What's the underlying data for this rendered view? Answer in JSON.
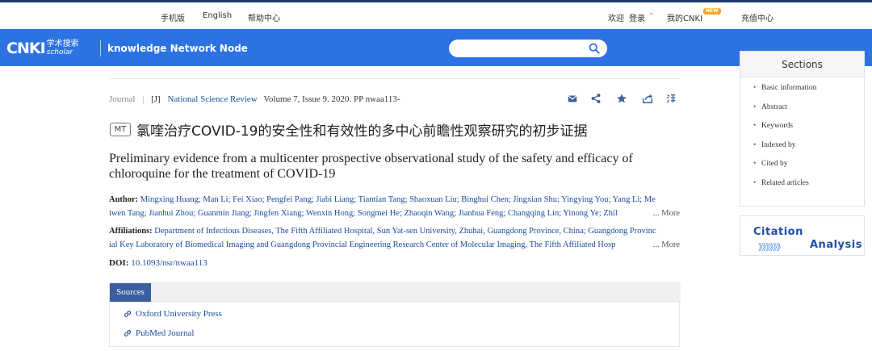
{
  "topbar": {
    "mobile": "手机版",
    "english": "English",
    "help": "帮助中心",
    "welcome": "欢迎",
    "login": "登录",
    "login_arrow": "⌄",
    "my_cnki": "我的CNKI",
    "new_badge": "NEW",
    "recharge": "充值中心"
  },
  "header": {
    "logo_main": "CNKI",
    "logo_cn": "学术搜索",
    "logo_en": "scholar",
    "site_name": "knowledge Network Node",
    "search_placeholder": ""
  },
  "article": {
    "journal_label": "Journal",
    "type_tag": "[J]",
    "journal_name": "National Science Review",
    "volume_info": "Volume 7, Issue 9. 2020. PP nwaa113-",
    "mt_badge": "MT",
    "title_cn": "氯喹治疗COVID-19的安全性和有效性的多中心前瞻性观察研究的初步证据",
    "title_en": "Preliminary evidence from a multicenter prospective observational study of the safety and efficacy of chloroquine for the treatment of COVID-19",
    "author_label": "Author:",
    "author_line1": "Mingxing Huang; Man Li; Fei Xiao; Pengfei Pang; Jiabi Liang; Tiantian Tang; Shaoxuan Liu; Binghui Chen; Jingxian Shu; Yingying You; Yang Li; Me",
    "author_line2": "iwen Tang; Jianhui Zhou; Guanmin Jiang; Jingfen Xiang; Wenxin Hong; Songmei He; Zhaoqin Wang; Jianhua Feng; Changqing Lin; Yinong Ye; Zhil",
    "affil_label": "Affiliations:",
    "affil_line1": "Department of Infectious Diseases, The Fifth Affiliated Hospital, Sun Yat-sen University, Zhuhai, Guangdong Province, China; Guangdong Provinc",
    "affil_line2": "ial Key Laboratory of Biomedical Imaging and Guangdong Provincial Engineering Research Center of Molecular Imaging, The Fifth Affiliated Hosp",
    "more": "... More",
    "doi_label": "DOI:",
    "doi_value": "10.1093/nsr/nwaa113"
  },
  "sources": {
    "tab": "Sources",
    "links": [
      "Oxford University Press",
      "PubMed Journal"
    ]
  },
  "sidebar": {
    "title": "Sections",
    "items": [
      "Basic information",
      "Abstract",
      "Keywords",
      "Indexed by",
      "Cited by",
      "Related articles"
    ]
  },
  "citation": {
    "word1": "Citation",
    "arrows": "》》》》》》",
    "word2": "Analysis"
  },
  "colors": {
    "header_blue": "#2d72e3",
    "link_blue": "#1a4b9c",
    "sources_tab": "#3b5e9e",
    "action_icon": "#3b5e9e"
  }
}
